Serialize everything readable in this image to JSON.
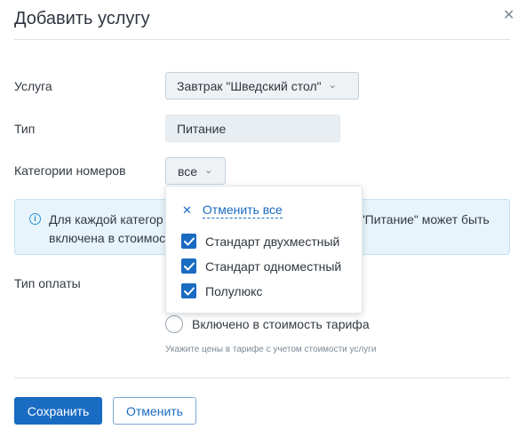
{
  "dialog": {
    "title": "Добавить услугу",
    "close_icon": "close-icon"
  },
  "form": {
    "service": {
      "label": "Услуга",
      "value": "Завтрак \"Шведский стол\""
    },
    "type": {
      "label": "Тип",
      "value": "Питание"
    },
    "room_categories": {
      "label": "Категории номеров",
      "value": "все"
    },
    "payment_type": {
      "label": "Тип оплаты"
    }
  },
  "info": {
    "icon": "info-icon",
    "line1_start": "Для каждой категор",
    "line1_end": "\"Питание\" может быть",
    "line2_start": "включена в стоимос"
  },
  "dropdown": {
    "cancel_all": "Отменить все",
    "options": [
      {
        "label": "Стандарт двухместный",
        "checked": true
      },
      {
        "label": "Стандарт одноместный",
        "checked": true
      },
      {
        "label": "Полулюкс",
        "checked": true
      }
    ]
  },
  "payment": {
    "option_label": "Включено в стоимость тарифа",
    "hint": "Укажите цены в тарифе с учетом стоимости услуги"
  },
  "footer": {
    "save_label": "Сохранить",
    "cancel_label": "Отменить"
  },
  "colors": {
    "accent": "#1a6bc2",
    "info_bg": "#e7f4fb"
  }
}
